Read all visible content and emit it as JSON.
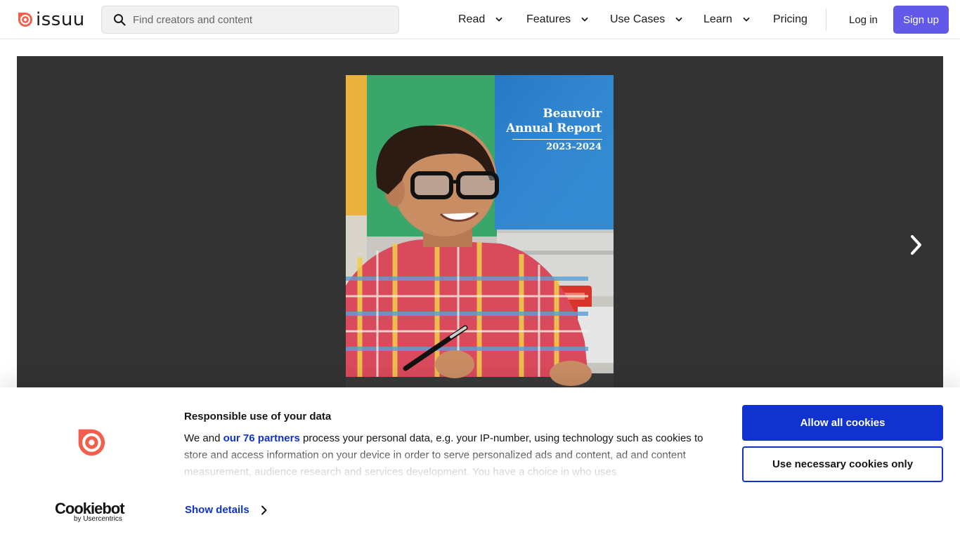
{
  "brand": {
    "name": "issuu",
    "accent": "#f25f4c"
  },
  "search": {
    "placeholder": "Find creators and content"
  },
  "nav": {
    "items": [
      {
        "label": "Read",
        "has_dropdown": true
      },
      {
        "label": "Features",
        "has_dropdown": true
      },
      {
        "label": "Use Cases",
        "has_dropdown": true
      },
      {
        "label": "Learn",
        "has_dropdown": true
      },
      {
        "label": "Pricing",
        "has_dropdown": false
      }
    ],
    "login": "Log in",
    "signup": "Sign up",
    "signup_color": "#6259e8"
  },
  "viewer": {
    "background": "#333333",
    "cover": {
      "title_line1": "Beauvoir",
      "title_line2": "Annual Report",
      "year": "2023–2024"
    },
    "next_icon": "chevron-right-icon"
  },
  "cookie_banner": {
    "title": "Responsible use of your data",
    "text_before_link": "We and ",
    "partners_link": "our 76 partners",
    "text_after_link": " process your personal data, e.g. your IP-number, using technology such as cookies to store and access information on your device in order to serve personalized ads and content, ad and content measurement, audience research and services development. You have a choice in who uses",
    "show_details": "Show details",
    "allow_all": "Allow all cookies",
    "necessary_only": "Use necessary cookies only",
    "provider": "Cookiebot",
    "provider_by": "by Usercentrics",
    "primary_color": "#1032cf"
  }
}
